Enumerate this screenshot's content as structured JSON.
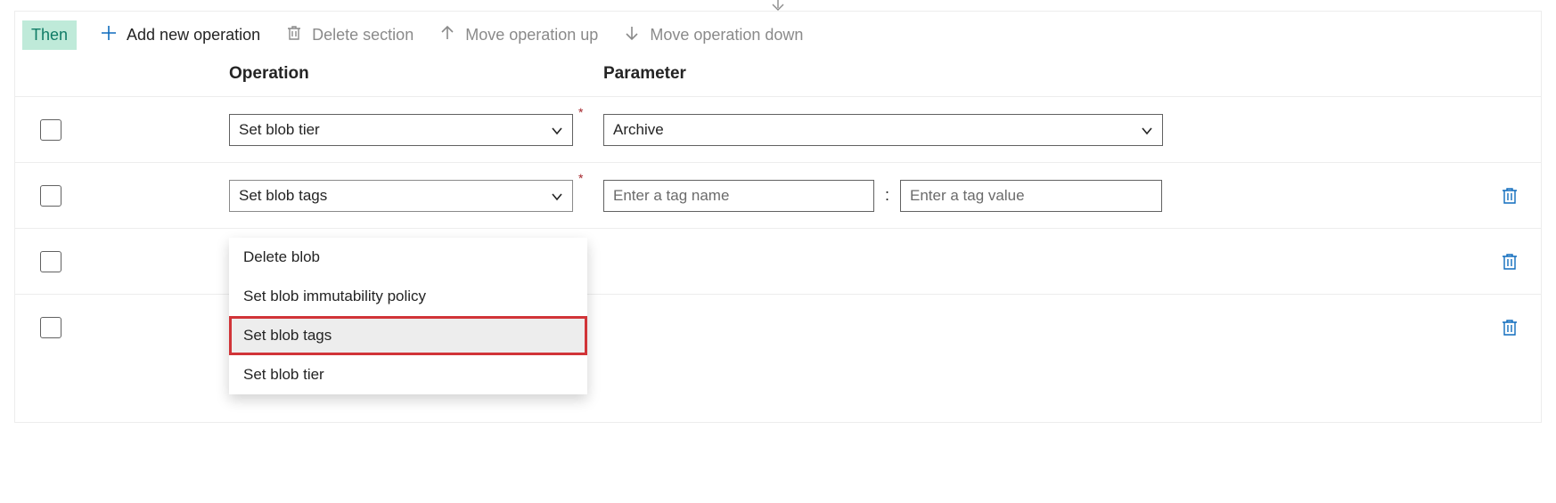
{
  "badge": "Then",
  "toolbar": {
    "add": "Add new operation",
    "delete": "Delete section",
    "up": "Move operation up",
    "down": "Move operation down"
  },
  "headers": {
    "operation": "Operation",
    "parameter": "Parameter"
  },
  "rows": [
    {
      "operation": "Set blob tier",
      "parameter_select": "Archive"
    },
    {
      "operation": "Set blob tags",
      "tag_name_placeholder": "Enter a tag name",
      "tag_value_placeholder": "Enter a tag value",
      "trash": true
    },
    {
      "operation": "",
      "trash": true
    },
    {
      "operation": "",
      "trash": true
    }
  ],
  "required_marker": "*",
  "colon": ":",
  "dropdown": {
    "open_for_row": 1,
    "items": [
      "Delete blob",
      "Set blob immutability policy",
      "Set blob tags",
      "Set blob tier"
    ],
    "highlighted": "Set blob tags"
  }
}
